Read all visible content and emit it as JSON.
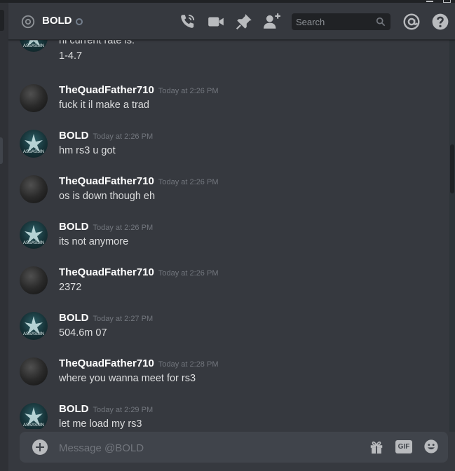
{
  "colors": {
    "background": "#36393f",
    "composer": "#40444b",
    "muted": "#72767d",
    "text": "#dcddde",
    "accent_white": "#ffffff"
  },
  "header": {
    "title": "BOLD",
    "search_placeholder": "Search",
    "icons": [
      "at-icon",
      "call-icon",
      "video-icon",
      "pin-icon",
      "add-friend-icon",
      "search-icon",
      "mentions-icon",
      "help-icon"
    ]
  },
  "messages": [
    {
      "author": "",
      "time": "",
      "lines": [
        "hi current rate is:",
        "1-4.7"
      ],
      "avatar": "bold"
    },
    {
      "author": "TheQuadFather710",
      "time": "Today at 2:26 PM",
      "lines": [
        "fuck it il make a trad"
      ],
      "avatar": "quad"
    },
    {
      "author": "BOLD",
      "time": "Today at 2:26 PM",
      "lines": [
        "hm rs3 u got"
      ],
      "avatar": "bold"
    },
    {
      "author": "TheQuadFather710",
      "time": "Today at 2:26 PM",
      "lines": [
        "os is down though eh"
      ],
      "avatar": "quad"
    },
    {
      "author": "BOLD",
      "time": "Today at 2:26 PM",
      "lines": [
        "its not anymore"
      ],
      "avatar": "bold"
    },
    {
      "author": "TheQuadFather710",
      "time": "Today at 2:26 PM",
      "lines": [
        "2372"
      ],
      "avatar": "quad"
    },
    {
      "author": "BOLD",
      "time": "Today at 2:27 PM",
      "lines": [
        "504.6m 07"
      ],
      "avatar": "bold"
    },
    {
      "author": "TheQuadFather710",
      "time": "Today at 2:28 PM",
      "lines": [
        "where you wanna meet for rs3"
      ],
      "avatar": "quad"
    },
    {
      "author": "BOLD",
      "time": "Today at 2:29 PM",
      "lines": [
        "let me load my rs3"
      ],
      "avatar": "bold"
    }
  ],
  "avatar_labels": {
    "bold": "ASSASSIN"
  },
  "composer": {
    "placeholder": "Message @BOLD",
    "gif_label": "GIF"
  }
}
